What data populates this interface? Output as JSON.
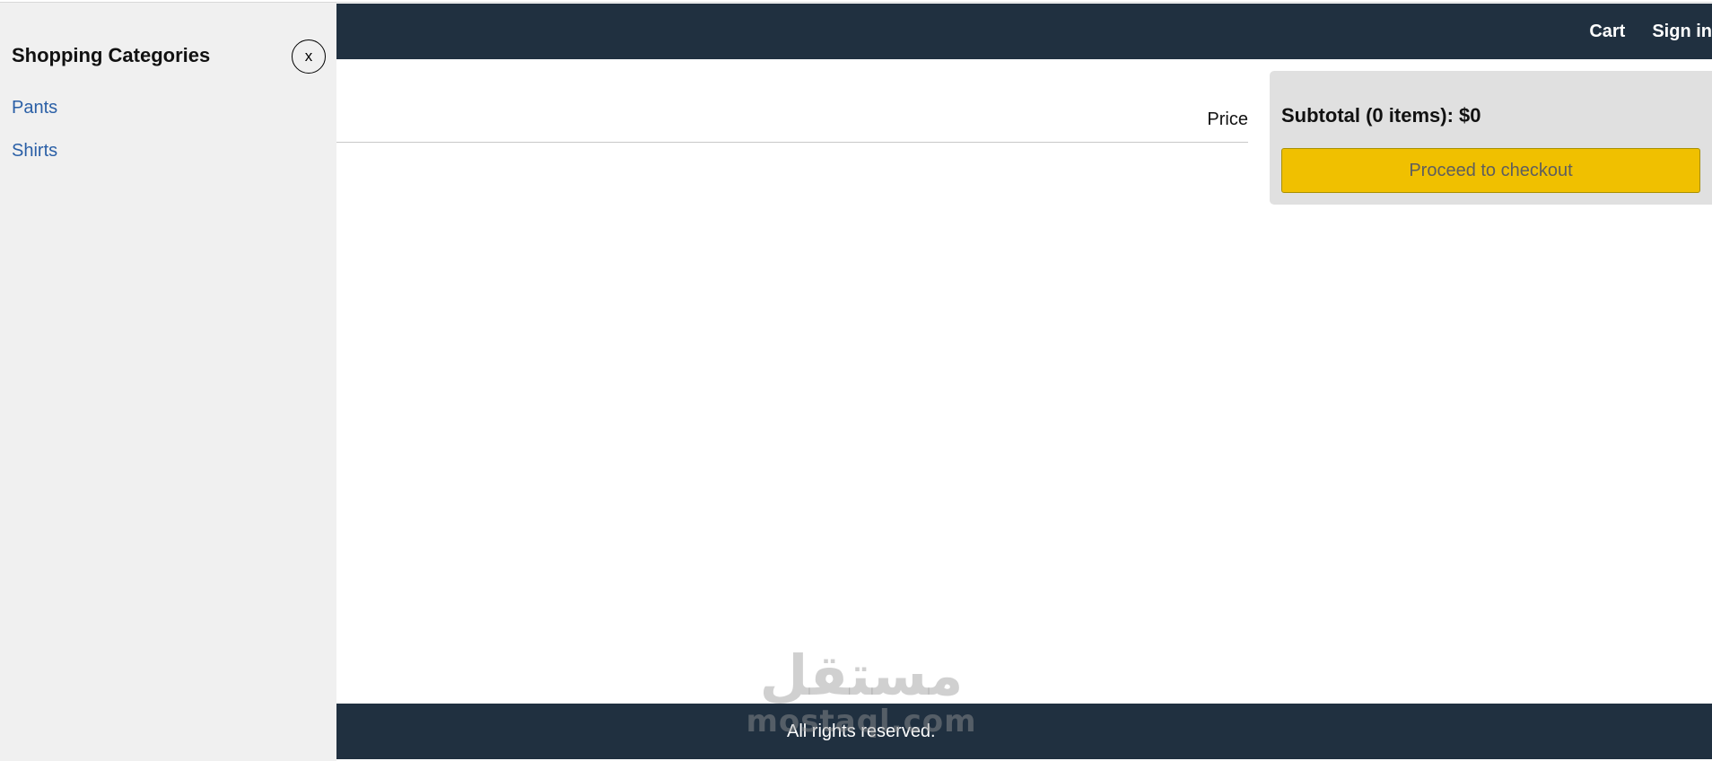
{
  "header": {
    "cart_label": "Cart",
    "signin_label": "Sign in"
  },
  "cart_table": {
    "price_header": "Price"
  },
  "summary": {
    "subtotal": "Subtotal (0 items): $0",
    "checkout_label": "Proceed to checkout"
  },
  "sidebar": {
    "title": "Shopping Categories",
    "close_label": "x",
    "categories": [
      {
        "label": "Pants"
      },
      {
        "label": "Shirts"
      }
    ]
  },
  "footer": {
    "text": "All rights reserved."
  },
  "watermark": {
    "arabic": "مستقل",
    "latin": "mostaql.com"
  },
  "colors": {
    "header_bg": "#203040",
    "footer_bg": "#203040",
    "sidebar_bg": "#f0f0f0",
    "summary_bg": "#e0e0e0",
    "checkout_bg": "#f0c000",
    "link": "#2a5fa6"
  }
}
